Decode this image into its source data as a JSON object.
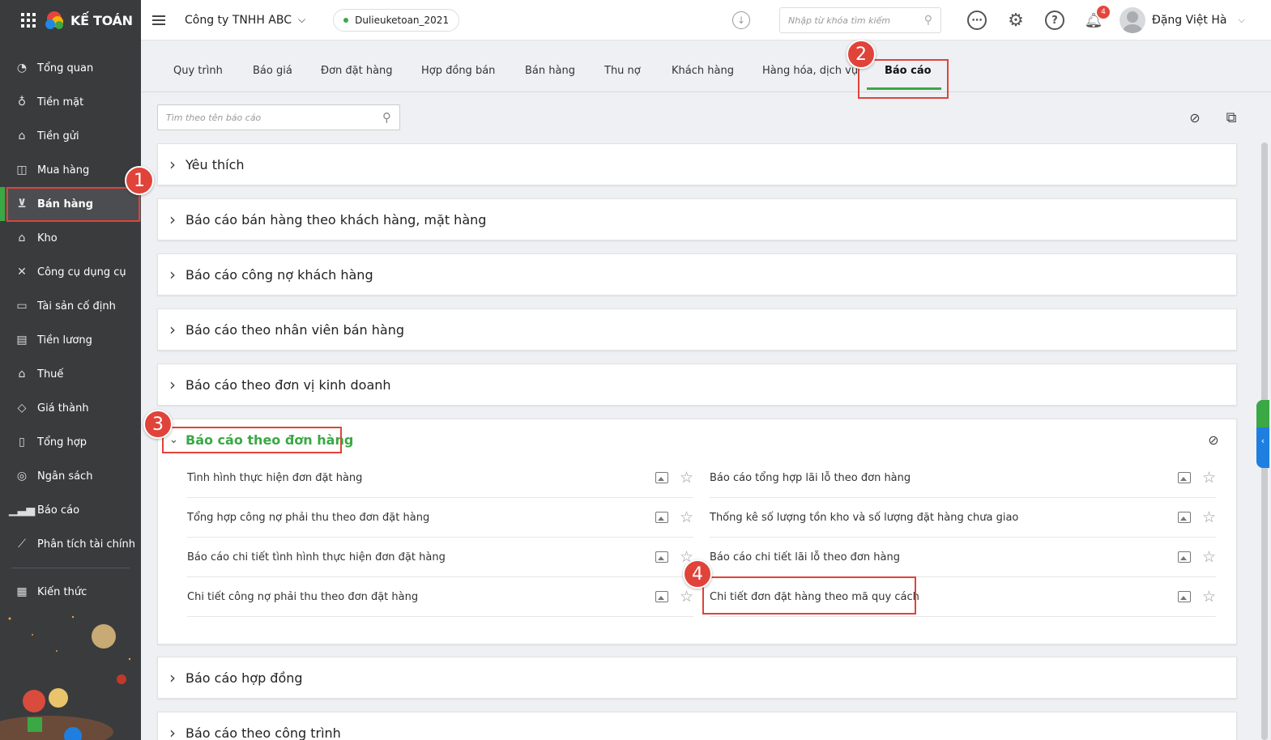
{
  "sidebar": {
    "brand": "KẾ TOÁN",
    "items": [
      {
        "label": "Tổng quan",
        "icon": "dashboard-icon",
        "glyph": "◔"
      },
      {
        "label": "Tiền mặt",
        "icon": "cash-bag-icon",
        "glyph": "♁"
      },
      {
        "label": "Tiền gửi",
        "icon": "bank-icon",
        "glyph": "⌂"
      },
      {
        "label": "Mua hàng",
        "icon": "shopping-bag-icon",
        "glyph": "◫"
      },
      {
        "label": "Bán hàng",
        "icon": "cart-icon",
        "glyph": "⊻"
      },
      {
        "label": "Kho",
        "icon": "warehouse-icon",
        "glyph": "⌂"
      },
      {
        "label": "Công cụ dụng cụ",
        "icon": "tools-icon",
        "glyph": "✕"
      },
      {
        "label": "Tài sản cố định",
        "icon": "car-icon",
        "glyph": "▭"
      },
      {
        "label": "Tiền lương",
        "icon": "payroll-icon",
        "glyph": "▤"
      },
      {
        "label": "Thuế",
        "icon": "tax-icon",
        "glyph": "⌂"
      },
      {
        "label": "Giá thành",
        "icon": "price-tag-icon",
        "glyph": "◇"
      },
      {
        "label": "Tổng hợp",
        "icon": "summary-doc-icon",
        "glyph": "▯"
      },
      {
        "label": "Ngân sách",
        "icon": "budget-icon",
        "glyph": "◎"
      },
      {
        "label": "Báo cáo",
        "icon": "bar-chart-icon",
        "glyph": "▁▃▅"
      },
      {
        "label": "Phân tích tài chính",
        "icon": "line-chart-icon",
        "glyph": "⟋"
      },
      {
        "label": "Kiến thức",
        "icon": "knowledge-book-icon",
        "glyph": "▦"
      }
    ]
  },
  "topbar": {
    "company": "Công ty TNHH ABC",
    "database": "Dulieuketoan_2021",
    "search_placeholder": "Nhập từ khóa tìm kiếm",
    "notification_count": "4",
    "user_name": "Đặng Việt Hà"
  },
  "tabs": [
    "Quy trình",
    "Báo giá",
    "Đơn đặt hàng",
    "Hợp đồng bán",
    "Bán hàng",
    "Thu nợ",
    "Khách hàng",
    "Hàng hóa, dịch vụ",
    "Báo cáo"
  ],
  "report_search_placeholder": "Tìm theo tên báo cáo",
  "groups": [
    "Yêu thích",
    "Báo cáo bán hàng theo khách hàng, mặt hàng",
    "Báo cáo công nợ khách hàng",
    "Báo cáo theo nhân viên bán hàng",
    "Báo cáo theo đơn vị kinh doanh",
    "Báo cáo theo đơn hàng",
    "Báo cáo hợp đồng",
    "Báo cáo theo công trình"
  ],
  "order_reports": {
    "left": [
      "Tình hình thực hiện đơn đặt hàng",
      "Tổng hợp công nợ phải thu theo đơn đặt hàng",
      "Báo cáo chi tiết tình hình thực hiện đơn đặt hàng",
      "Chi tiết công nợ phải thu theo đơn đặt hàng"
    ],
    "right": [
      "Báo cáo tổng hợp lãi lỗ theo đơn hàng",
      "Thống kê số lượng tồn kho và số lượng đặt hàng chưa giao",
      "Báo cáo chi tiết lãi lỗ theo đơn hàng",
      "Chi tiết đơn đặt hàng theo mã quy cách"
    ]
  },
  "steps": [
    "1",
    "2",
    "3",
    "4"
  ],
  "colors": {
    "accent": "#3aa845",
    "highlight": "#e0433a",
    "sidebar": "#3a3b3d"
  }
}
